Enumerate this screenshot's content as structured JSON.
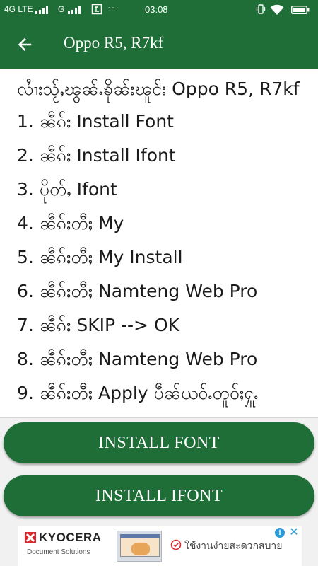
{
  "status_bar": {
    "network_1": "4G LTE",
    "network_2": "G",
    "dots": "···",
    "time": "03:08"
  },
  "app_bar": {
    "title": "Oppo R5, R7kf"
  },
  "instructions": {
    "heading": "လၢႆးသႂ်ႇၽွၼ်ႉၶိုၼ်းၽူင်း Oppo R5, R7kf",
    "steps": [
      "1. ၼဵၵ်း Install Font",
      "2. ၼဵၵ်း Install Ifont",
      "3. ပိုတ်ႇ Ifont",
      "4. ၼဵၵ်းတီႈ My",
      "5. ၼဵၵ်းတီႈ My Install",
      "6. ၼဵၵ်းတီႈ Namteng Web Pro",
      "7. ၼဵၵ်း SKIP  -->  OK",
      "8. ၼဵၵ်းတီႈ Namteng Web Pro",
      "9. ၼဵၵ်းတီႈ Apply ပဵၼ်ယဝ်ႉတူဝ်ႈႁူႉ"
    ]
  },
  "buttons": {
    "install_font": "INSTALL FONT",
    "install_ifont": "INSTALL IFONT"
  },
  "ad": {
    "brand": "KYOCERA",
    "subtitle": "Document Solutions",
    "text": "ใช้งานง่ายสะดวกสบาย"
  },
  "colors": {
    "primary": "#1f6e37",
    "background": "#f1f1f1",
    "ad_accent": "#2b9bd6",
    "brand_red": "#d7282f"
  }
}
